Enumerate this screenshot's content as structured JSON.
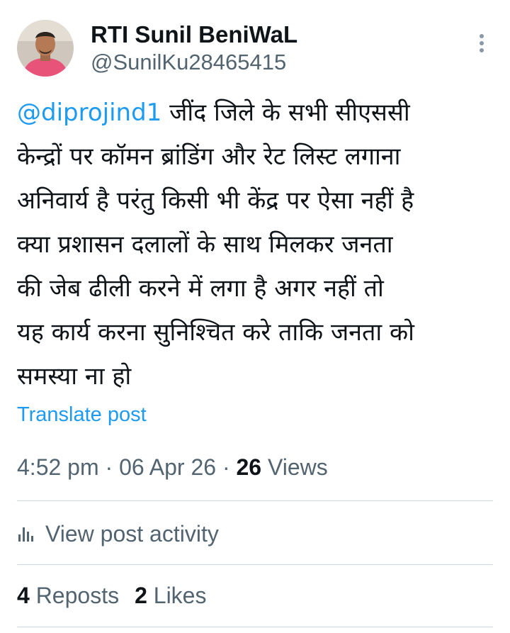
{
  "author": {
    "name": "RTI Sunil BeniWaL",
    "handle": "@SunilKu28465415"
  },
  "more_icon": "more-vertical-icon",
  "post": {
    "mention": "@diprojind1",
    "lines": [
      " जींद जिले के सभी सीएससी",
      "केन्द्रों पर कॉमन ब्रांडिंग और रेट लिस्ट लगाना",
      "अनिवार्य है परंतु किसी भी केंद्र पर ऐसा नहीं है",
      "क्या प्रशासन दलालों के साथ मिलकर जनता",
      "की जेब ढीली करने में लगा है अगर नहीं तो",
      "यह कार्य करना सुनिश्चित करे ताकि जनता को",
      "समस्या ना हो"
    ],
    "translate_label": "Translate post"
  },
  "meta": {
    "time": "4:52 pm",
    "separator": " · ",
    "date": "06 Apr 26",
    "views_count": "26",
    "views_label": " Views"
  },
  "activity": {
    "icon": "analytics-bars-icon",
    "label": "View post activity"
  },
  "stats": {
    "reposts_count": "4",
    "reposts_label": " Reposts",
    "likes_count": "2",
    "likes_label": " Likes"
  },
  "colors": {
    "text_primary": "#0f1419",
    "text_secondary": "#536471",
    "link": "#1d9bf0",
    "divider": "#cfd9de"
  }
}
